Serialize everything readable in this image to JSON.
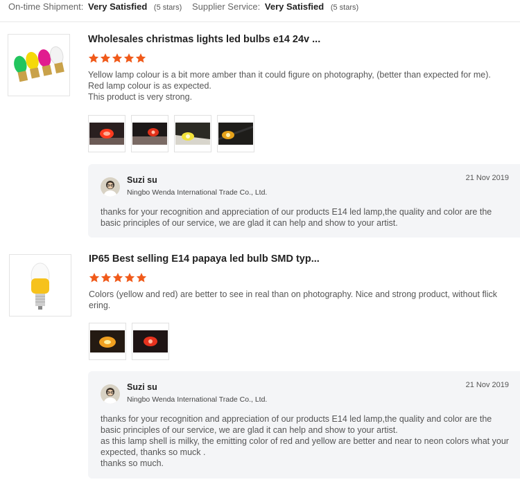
{
  "ratings_summary": {
    "shipment_label": "On-time Shipment:",
    "shipment_value": "Very Satisfied",
    "shipment_stars": "(5 stars)",
    "service_label": "Supplier Service:",
    "service_value": "Very Satisfied",
    "service_stars": "(5 stars)"
  },
  "colors": {
    "star": "#f05a1a",
    "reply_bg": "#f4f5f7"
  },
  "reviews": [
    {
      "title": "Wholesales christmas lights led bulbs e14 24v ...",
      "rating": 5,
      "text": [
        "Yellow lamp colour is a bit more amber than it could figure on photography, (better than expected for me).",
        "Red lamp colour is as expected.",
        "This product is very strong."
      ],
      "reply": {
        "name": "Suzi su",
        "company": "Ningbo Wenda International Trade Co., Ltd.",
        "date": "21 Nov 2019",
        "text": [
          "thanks for your recognition and appreciation of our products E14 led lamp,the quality and color are the",
          "basic principles of our service, we are glad it can help and show to your artist."
        ]
      }
    },
    {
      "title": "IP65 Best selling E14 papaya led bulb SMD typ...",
      "rating": 5,
      "text": [
        "Colors (yellow and red) are better to see in real than on photography. Nice and strong product, without flick",
        "ering."
      ],
      "reply": {
        "name": "Suzi su",
        "company": "Ningbo Wenda International Trade Co., Ltd.",
        "date": "21 Nov 2019",
        "text": [
          "thanks for your recognition and appreciation of our products E14 led lamp,the quality and color are the",
          "basic principles of our service, we are glad it can help and show to your artist.",
          "as this lamp shell is milky, the emitting color of red and yellow are better and near to neon colors what your",
          "expected, thanks so muck .",
          "thanks so much."
        ]
      }
    }
  ]
}
